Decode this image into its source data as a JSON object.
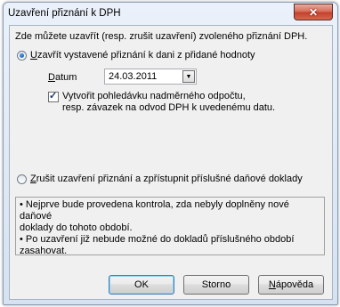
{
  "window": {
    "title": "Uzavření přiznání k DPH",
    "close_label": "✕"
  },
  "intro": "Zde můžete uzavřít (resp. zrušit uzavření) zvoleného přiznání DPH.",
  "option_close": {
    "key": "U",
    "rest": "zavřít vystavené přiznání k dani z přidané hodnoty",
    "selected": true
  },
  "date": {
    "key": "D",
    "rest": "atum",
    "value": "24.03.2011"
  },
  "checkbox": {
    "checked": true,
    "line1": "Vytvořit pohledávku nadměrného odpočtu,",
    "line2": "resp. závazek na odvod DPH k uvedenému datu."
  },
  "option_cancel": {
    "key": "Z",
    "rest": "rušit uzavření přiznání a zpřístupnit příslušné daňové doklady",
    "selected": false
  },
  "info_lines": [
    "• Nejprve bude provedena kontrola, zda nebyly doplněny nové daňové",
    "doklady do tohoto období.",
    "• Po uzavření již nebude možné do dokladů příslušného období",
    "zasahovat."
  ],
  "buttons": {
    "ok": "OK",
    "storno": "Storno",
    "help_key": "N",
    "help_rest": "ápověda"
  }
}
